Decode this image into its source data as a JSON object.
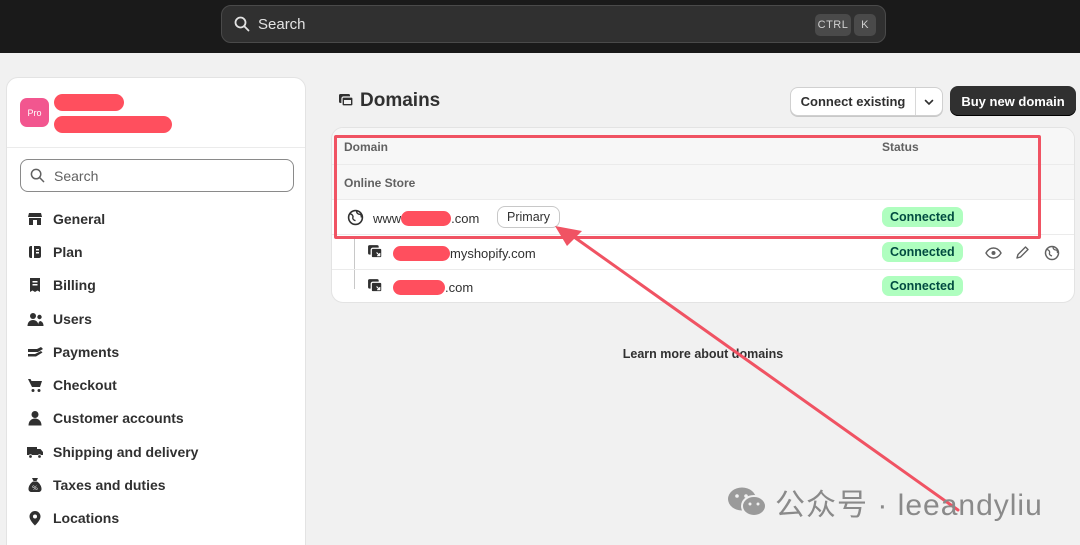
{
  "topbar": {
    "search_label": "Search",
    "shortcut_ctrl": "CTRL",
    "shortcut_k": "K"
  },
  "sidebar": {
    "store_badge": "Pro",
    "search_placeholder": "Search",
    "items": [
      {
        "label": "General",
        "icon": "store-icon"
      },
      {
        "label": "Plan",
        "icon": "plan-icon"
      },
      {
        "label": "Billing",
        "icon": "receipt-icon"
      },
      {
        "label": "Users",
        "icon": "users-icon"
      },
      {
        "label": "Payments",
        "icon": "payments-icon"
      },
      {
        "label": "Checkout",
        "icon": "cart-icon"
      },
      {
        "label": "Customer accounts",
        "icon": "person-icon"
      },
      {
        "label": "Shipping and delivery",
        "icon": "truck-icon"
      },
      {
        "label": "Taxes and duties",
        "icon": "tax-icon"
      },
      {
        "label": "Locations",
        "icon": "location-icon"
      }
    ]
  },
  "main": {
    "title": "Domains",
    "connect_existing_label": "Connect existing",
    "buy_new_domain_label": "Buy new domain",
    "table": {
      "col_domain": "Domain",
      "col_status": "Status",
      "group_label": "Online Store",
      "rows": [
        {
          "prefix": "www",
          "suffix": ".com",
          "badge": "Primary",
          "status": "Connected"
        },
        {
          "prefix": "",
          "suffix": "myshopify.com",
          "status": "Connected"
        },
        {
          "prefix": "",
          "suffix": ".com",
          "status": "Connected"
        }
      ]
    },
    "learn_more": "Learn more about domains"
  },
  "watermark": "公众号 · leeandyliu",
  "colors": {
    "topbar_bg": "#1a1a1a",
    "status_green": "#affebf",
    "annotation_red": "#f05363",
    "avatar_pink": "#f2568f"
  }
}
